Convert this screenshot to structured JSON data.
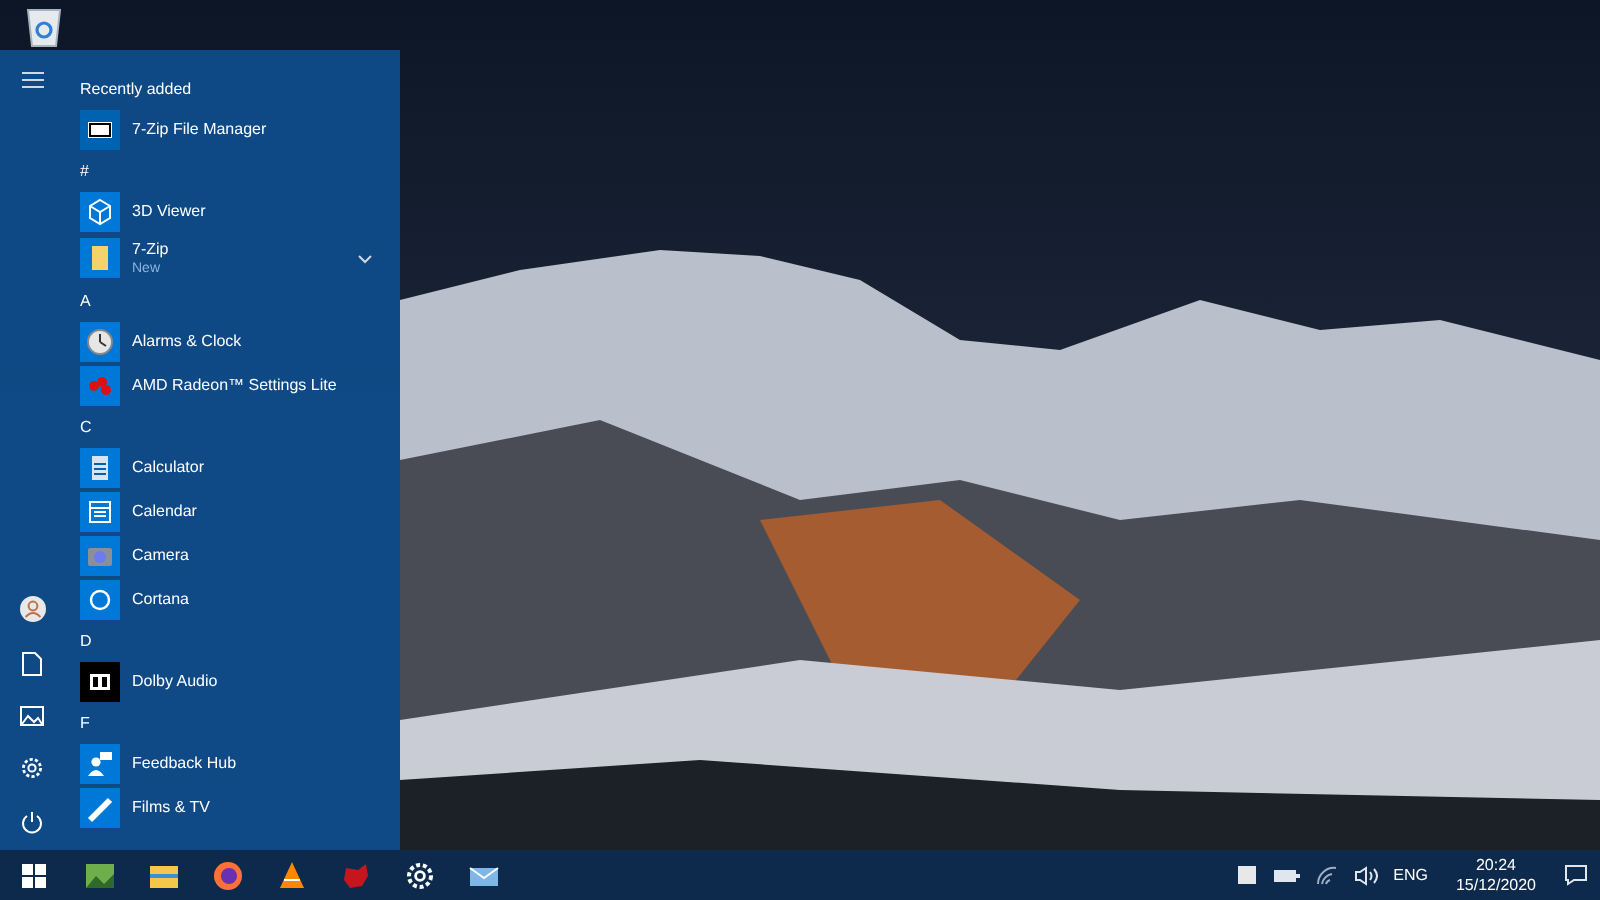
{
  "start_menu": {
    "recent": {
      "heading": "Recently added",
      "apps": [
        {
          "name": "7-Zip File Manager",
          "kind": "sevenzip",
          "expandable": false
        }
      ]
    },
    "groups": [
      {
        "letter": "#",
        "apps": [
          {
            "name": "3D Viewer",
            "kind": "cube",
            "expandable": false
          },
          {
            "name": "7-Zip",
            "subtitle": "New",
            "kind": "folder",
            "expandable": true
          }
        ]
      },
      {
        "letter": "A",
        "apps": [
          {
            "name": "Alarms & Clock",
            "kind": "clock",
            "expandable": false
          },
          {
            "name": "AMD Radeon™ Settings Lite",
            "kind": "amd",
            "expandable": false
          }
        ]
      },
      {
        "letter": "C",
        "apps": [
          {
            "name": "Calculator",
            "kind": "calculator",
            "expandable": false
          },
          {
            "name": "Calendar",
            "kind": "calendar",
            "expandable": false
          },
          {
            "name": "Camera",
            "kind": "camera",
            "expandable": false
          },
          {
            "name": "Cortana",
            "kind": "cortana",
            "expandable": false
          }
        ]
      },
      {
        "letter": "D",
        "apps": [
          {
            "name": "Dolby Audio",
            "kind": "dolby",
            "expandable": false
          }
        ]
      },
      {
        "letter": "F",
        "apps": [
          {
            "name": "Feedback Hub",
            "kind": "feedback",
            "expandable": false
          },
          {
            "name": "Films & TV",
            "kind": "film",
            "expandable": false
          }
        ]
      }
    ]
  },
  "taskbar": {
    "pinned": [
      {
        "kind": "photos"
      },
      {
        "kind": "explorer"
      },
      {
        "kind": "firefox"
      },
      {
        "kind": "vlc"
      },
      {
        "kind": "game"
      },
      {
        "kind": "settings"
      },
      {
        "kind": "mail"
      }
    ],
    "language": "ENG",
    "time": "20:24",
    "date": "15/12/2020"
  }
}
